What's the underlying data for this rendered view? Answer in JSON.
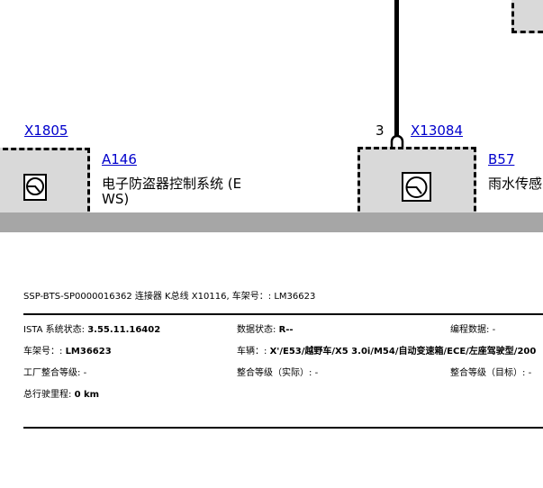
{
  "diagram": {
    "connector_left": "X1805",
    "component_left": "A146",
    "component_left_desc_line1": "电子防盗器控制系统 (E",
    "component_left_desc_line2": "WS)",
    "pin_number": "3",
    "connector_right": "X13084",
    "component_right": "B57",
    "component_right_desc": "雨水传感"
  },
  "document": {
    "title": "SSP-BTS-SP0000016362 连接器 K总线 X10116, 车架号：: LM36623"
  },
  "info": {
    "istaLabel": "ISTA 系统状态: ",
    "istaValue": "3.55.11.16402",
    "dataLabel": "数据状态: ",
    "dataValue": "R--",
    "progLabel": "编程数据: ",
    "progValue": "-",
    "vinLabel": "车架号：: ",
    "vinValue": "LM36623",
    "vehicleLabel": "车辆：: ",
    "vehicleValue": "X'/E53/越野车/X5 3.0i/M54/自动变速箱/ECE/左座驾驶型/200",
    "factoryLabel": "工厂整合等级: ",
    "factoryValue": "-",
    "actualLabel": "整合等级（实际）: ",
    "actualValue": "-",
    "targetLabel": "整合等级（目标）: ",
    "targetValue": "-",
    "mileageLabel": "总行驶里程: ",
    "mileageValue": "0 km"
  }
}
